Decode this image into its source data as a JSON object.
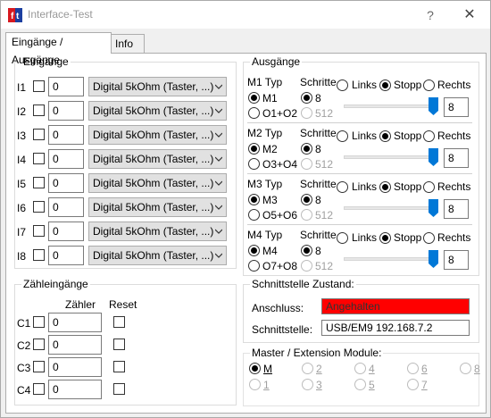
{
  "window": {
    "title": "Interface-Test",
    "help": "?",
    "close": "✕"
  },
  "tabs": [
    {
      "label": "Eingänge / Ausgänge"
    },
    {
      "label": "Info"
    }
  ],
  "inputs": {
    "title": "Eingänge",
    "rows": [
      {
        "label": "I1",
        "value": "0",
        "mode": "Digital 5kOhm (Taster, ...)"
      },
      {
        "label": "I2",
        "value": "0",
        "mode": "Digital 5kOhm (Taster, ...)"
      },
      {
        "label": "I3",
        "value": "0",
        "mode": "Digital 5kOhm (Taster, ...)"
      },
      {
        "label": "I4",
        "value": "0",
        "mode": "Digital 5kOhm (Taster, ...)"
      },
      {
        "label": "I5",
        "value": "0",
        "mode": "Digital 5kOhm (Taster, ...)"
      },
      {
        "label": "I6",
        "value": "0",
        "mode": "Digital 5kOhm (Taster, ...)"
      },
      {
        "label": "I7",
        "value": "0",
        "mode": "Digital 5kOhm (Taster, ...)"
      },
      {
        "label": "I8",
        "value": "0",
        "mode": "Digital 5kOhm (Taster, ...)"
      }
    ]
  },
  "counters": {
    "title": "Zähleingänge",
    "col_counter": "Zähler",
    "col_reset": "Reset",
    "rows": [
      {
        "label": "C1",
        "value": "0"
      },
      {
        "label": "C2",
        "value": "0"
      },
      {
        "label": "C3",
        "value": "0"
      },
      {
        "label": "C4",
        "value": "0"
      }
    ]
  },
  "outputs": {
    "title": "Ausgänge",
    "steps_label": "Schritte",
    "dir_left": "Links",
    "dir_stop": "Stopp",
    "dir_right": "Rechts",
    "motors": [
      {
        "type_label": "M1 Typ",
        "opt_motor": "M1",
        "opt_outputs": "O1+O2",
        "steps_a": "8",
        "steps_b": "512",
        "speed": "8",
        "level_fraction": 1.0
      },
      {
        "type_label": "M2 Typ",
        "opt_motor": "M2",
        "opt_outputs": "O3+O4",
        "steps_a": "8",
        "steps_b": "512",
        "speed": "8",
        "level_fraction": 1.0
      },
      {
        "type_label": "M3 Typ",
        "opt_motor": "M3",
        "opt_outputs": "O5+O6",
        "steps_a": "8",
        "steps_b": "512",
        "speed": "8",
        "level_fraction": 1.0
      },
      {
        "type_label": "M4 Typ",
        "opt_motor": "M4",
        "opt_outputs": "O7+O8",
        "steps_a": "8",
        "steps_b": "512",
        "speed": "8",
        "level_fraction": 1.0
      }
    ]
  },
  "interface": {
    "title": "Schnittstelle Zustand:",
    "connection_label": "Anschluss:",
    "connection_value": "Angehalten",
    "connection_color": "#ff0000",
    "port_label": "Schnittstelle:",
    "port_value": "USB/EM9 192.168.7.2"
  },
  "modules": {
    "title": "Master / Extension Module:",
    "options": [
      "M",
      "2",
      "4",
      "6",
      "8",
      "1",
      "3",
      "5",
      "7"
    ],
    "selected": "M"
  }
}
